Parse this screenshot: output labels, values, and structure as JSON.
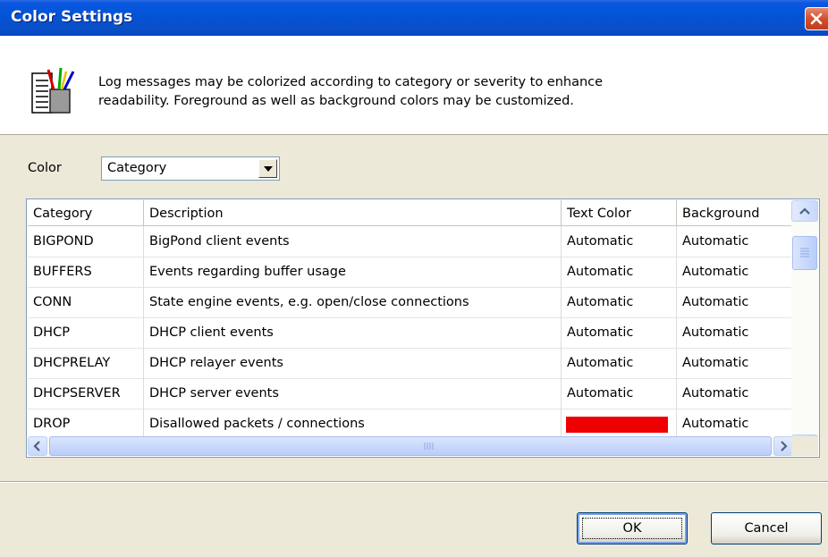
{
  "window": {
    "title": "Color Settings",
    "close_icon": "close-icon"
  },
  "header": {
    "icon": "palette-brushes-icon",
    "text_line1": "Log messages may be colorized according to category or severity to enhance",
    "text_line2": "readability. Foreground as well as background colors may be customized."
  },
  "color_select": {
    "label": "Color",
    "value": "Category"
  },
  "table": {
    "columns": [
      "Category",
      "Description",
      "Text Color",
      "Background"
    ],
    "rows": [
      {
        "category": "BIGPOND",
        "description": "BigPond client events",
        "text_color": "Automatic",
        "background": "Automatic"
      },
      {
        "category": "BUFFERS",
        "description": "Events regarding buffer usage",
        "text_color": "Automatic",
        "background": "Automatic"
      },
      {
        "category": "CONN",
        "description": "State engine events, e.g. open/close connections",
        "text_color": "Automatic",
        "background": "Automatic"
      },
      {
        "category": "DHCP",
        "description": "DHCP client events",
        "text_color": "Automatic",
        "background": "Automatic"
      },
      {
        "category": "DHCPRELAY",
        "description": "DHCP relayer events",
        "text_color": "Automatic",
        "background": "Automatic"
      },
      {
        "category": "DHCPSERVER",
        "description": "DHCP server events",
        "text_color": "Automatic",
        "background": "Automatic"
      },
      {
        "category": "DROP",
        "description": "Disallowed packets / connections",
        "text_color_swatch": "#ee0000",
        "background": "Automatic"
      }
    ]
  },
  "buttons": {
    "ok": "OK",
    "cancel": "Cancel"
  },
  "colors": {
    "titlebar": "#0254d8",
    "dialog_bg": "#ece9d8",
    "drop_text_color": "#ee0000"
  }
}
